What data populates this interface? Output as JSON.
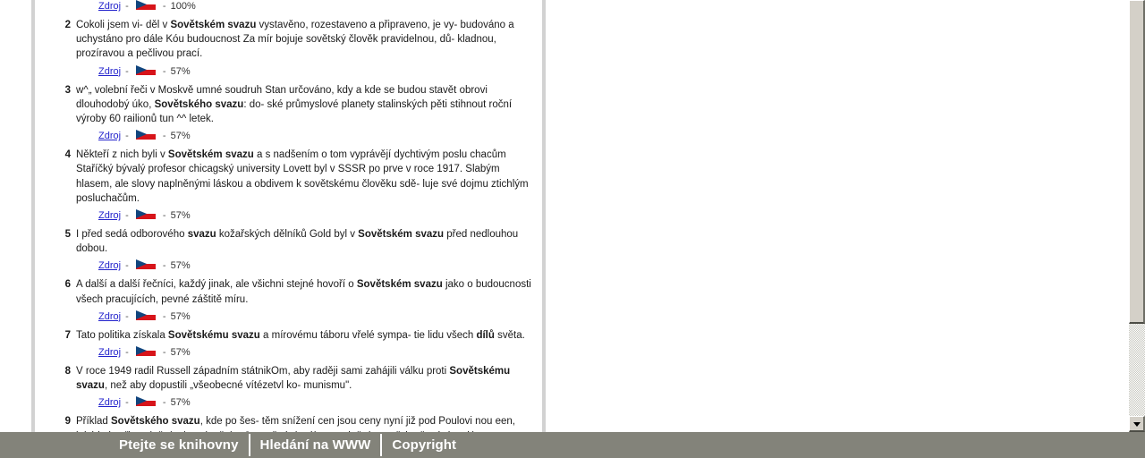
{
  "scrollbar": {
    "down_arrow_icon": "chevron-down-icon",
    "thumb_position_pct": 0
  },
  "results": {
    "source_label": "Zdroj",
    "dash": "-",
    "flag_icon": "czech-flag-icon",
    "items": [
      {
        "number": "",
        "text_html": "",
        "percent": "100%",
        "partial_top": true
      },
      {
        "number": "2",
        "text_html": "Cokoli jsem vi- děl v <b>Sovětském svazu</b> vystavěno, rozestaveno a připraveno, je vy- budováno a uchystáno pro dále Kóu budoucnost Za mír bojuje sovětský člověk pravidelnou, dů- kladnou, prozíravou a pečlivou prací.",
        "percent": "57%"
      },
      {
        "number": "3",
        "text_html": "w^„ volební řeči v Moskvě umné soudruh Stan určováno, kdy a kde se budou stavět obrovi dlouhodobý úko, <b>Sovětského svazu</b>: do- ské průmyslové planety stalinských pěti stihnout roční výroby 60 railionů tun ^^ letek.",
        "percent": "57%"
      },
      {
        "number": "4",
        "text_html": "Někteří z nich byli v <b>Sovětském svazu</b> a s nadšením o tom vyprávějí dychtivým poslu chacům Staříčký bývalý profesor chicagský university Lovett byl v SSSR po prve v roce 1917. Slabým hlasem, ale slovy naplněnými láskou a obdivem k sovětskému člověku sdě- luje své dojmu ztichlým posluchačům.",
        "percent": "57%"
      },
      {
        "number": "5",
        "text_html": "I před sedá odborového <b>svazu</b> kožařských dělníků Gold byl v <b>Sovětském svazu</b> před nedlouhou dobou.",
        "percent": "57%"
      },
      {
        "number": "6",
        "text_html": "A další a další řečníci, každý jinak, ale všichni stejné hovoří o <b>Sovětském svazu</b> jako o budoucnosti všech pracujících, pevné záštitě míru.",
        "percent": "57%"
      },
      {
        "number": "7",
        "text_html": "Tato politika získala <b>Sovětskému svazu</b> a mírovému táboru vřelé sympa- tie lidu všech <b>dílů</b> světa.",
        "percent": "57%"
      },
      {
        "number": "8",
        "text_html": "V roce 1949 radil Russell západním státnikOm, aby raději sami zahájili válku proti <b>Sovětskému svazu</b>, než aby dopustili „všeobecné vítézetvl ko- munismu\".",
        "percent": "57%"
      },
      {
        "number": "9",
        "text_html": "Příklad <b>Sovětského svazu</b>, kde po šes- těm snížení cen jsou ceny nyní již pod Poulovi nou een, jaké byly při uvolnění, ukazuje, čeho Je možné dosáhnout plněním a překračováním plánu.",
        "percent": ""
      }
    ]
  },
  "footer": {
    "links": [
      "Ptejte se knihovny",
      "Hledání na WWW",
      "Copyright"
    ]
  },
  "colors": {
    "footer_bg": "#83837a",
    "link": "#2222cc",
    "flag_red": "#d7141a",
    "flag_blue": "#11457e",
    "rule": "#d2d2d2"
  }
}
